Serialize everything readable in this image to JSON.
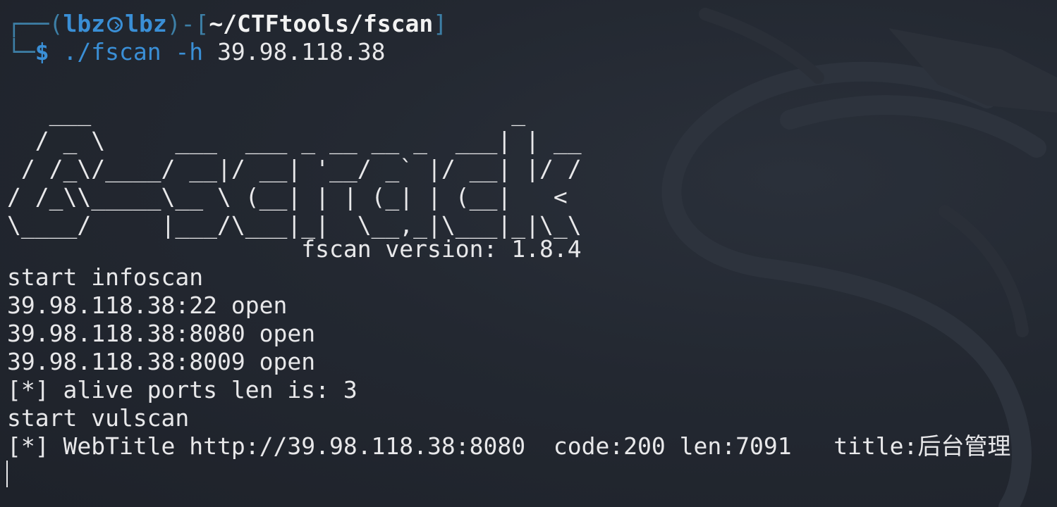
{
  "prompt": {
    "frame_open": "┌──(",
    "user": "lbz",
    "host": "lbz",
    "frame_mid": ")-[",
    "cwd": "~/CTFtools/fscan",
    "frame_close": "]",
    "frame_bottom": "└─",
    "symbol": "$",
    "command": "./fscan -h",
    "argument": "39.98.118.38"
  },
  "banner": {
    "ascii_art": "   ___                              _    \n  / _ \\     ___  ___ _ __ __ _  ___| | __ \n / /_\\/____/ __|/ __| '__/ _` |/ __| |/ /\n/ /_\\\\_____\\__ \\ (__| | | (_| | (__|   <    \n\\____/     |___/\\___|_|  \\__,_|\\___|_|\\_\\   ",
    "version": "                     fscan version: 1.8.4"
  },
  "output": [
    "start infoscan",
    "39.98.118.38:22 open",
    "39.98.118.38:8080 open",
    "39.98.118.38:8009 open",
    "[*] alive ports len is: 3",
    "start vulscan",
    "[*] WebTitle http://39.98.118.38:8080  code:200 len:7091   title:后台管理"
  ],
  "colors": {
    "background": "#20252e",
    "prompt_blue": "#3a8fd6",
    "frame": "#3d7fa6",
    "text": "#e8e8ea"
  },
  "icons": {
    "prompt_separator": "kali-skull-icon"
  }
}
